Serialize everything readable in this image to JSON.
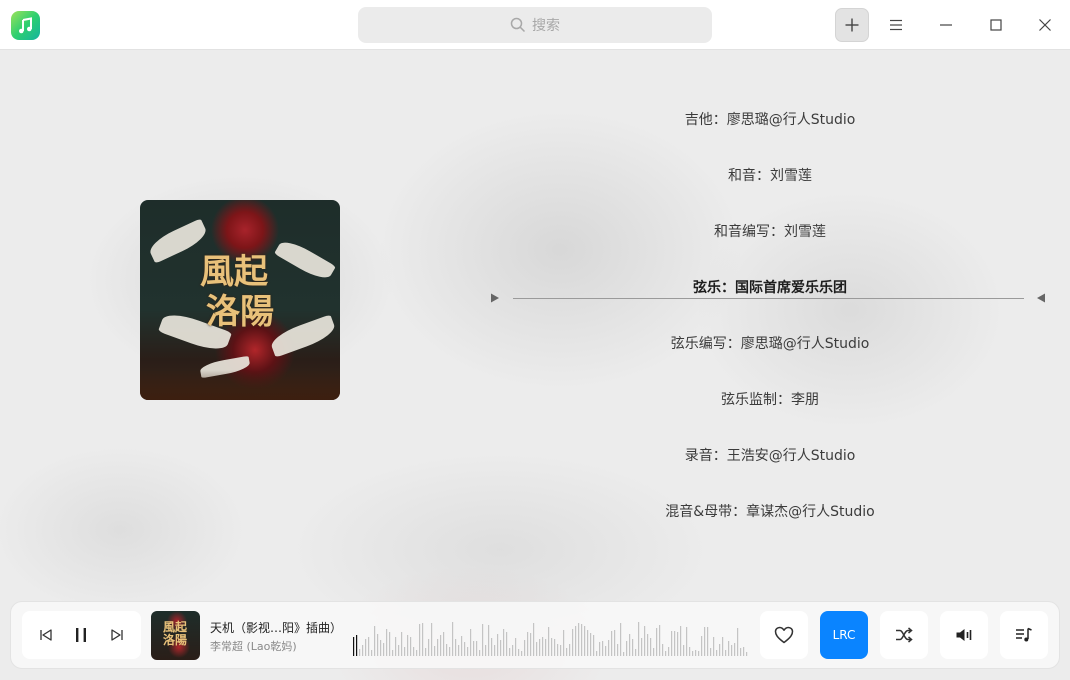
{
  "titlebar": {
    "app_icon": "music-note-icon",
    "search_placeholder": "搜索",
    "buttons": [
      "add-icon",
      "menu-icon",
      "minimize-icon",
      "maximize-icon",
      "close-icon"
    ]
  },
  "lyrics": {
    "lines": [
      {
        "text": "吉他：廖思璐@行人Studio",
        "current": false
      },
      {
        "text": "和音：刘雪莲",
        "current": false
      },
      {
        "text": "和音编写：刘雪莲",
        "current": false
      },
      {
        "text": "弦乐：国际首席爱乐乐团",
        "current": true
      },
      {
        "text": "弦乐编写：廖思璐@行人Studio",
        "current": false
      },
      {
        "text": "弦乐监制：李朋",
        "current": false
      },
      {
        "text": "录音：王浩安@行人Studio",
        "current": false
      },
      {
        "text": "混音&母带：章谋杰@行人Studio",
        "current": false
      }
    ]
  },
  "player": {
    "title": "天机（影视…阳》插曲）",
    "artist": "李常超 (Lao乾妈)",
    "lrc_label": "LRC",
    "state": "playing",
    "accent_color": "#0a84ff",
    "controls": [
      "previous-icon",
      "pause-icon",
      "next-icon"
    ],
    "right_buttons": [
      "heart-icon",
      "lrc",
      "shuffle-icon",
      "volume-icon",
      "playlist-icon"
    ]
  }
}
